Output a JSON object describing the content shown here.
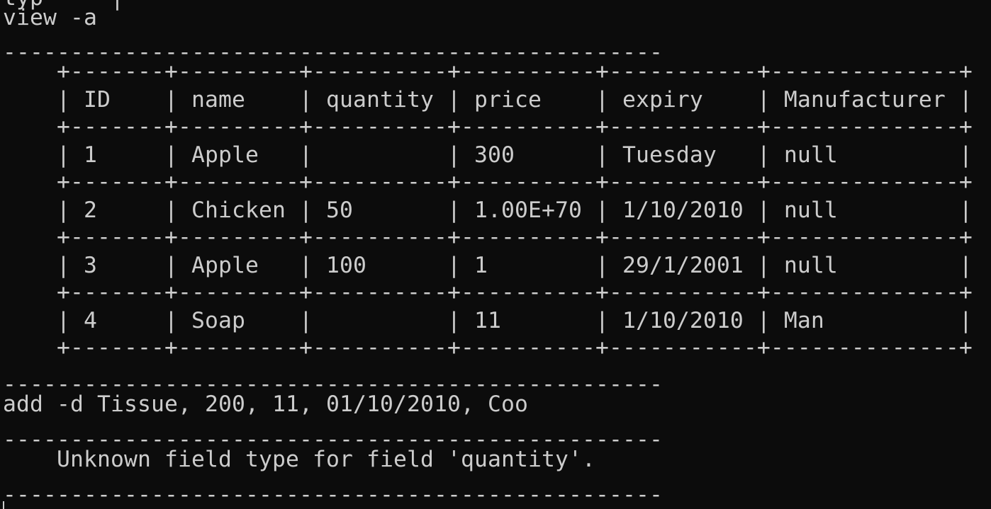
{
  "terminal": {
    "lines": [
      "typ  -  |",
      "view -a",
      "-------------------------------------------------",
      "    +-------+---------+----------+----------+-----------+--------------+",
      "    | ID    | name    | quantity | price    | expiry    | Manufacturer |",
      "    +-------+---------+----------+----------+-----------+--------------+",
      "    | 1     | Apple   |          | 300      | Tuesday   | null         |",
      "    +-------+---------+----------+----------+-----------+--------------+",
      "    | 2     | Chicken | 50       | 1.00E+70 | 1/10/2010 | null         |",
      "    +-------+---------+----------+----------+-----------+--------------+",
      "    | 3     | Apple   | 100      | 1        | 29/1/2001 | null         |",
      "    +-------+---------+----------+----------+-----------+--------------+",
      "    | 4     | Soap    |          | 11       | 1/10/2010 | Man          |",
      "    +-------+---------+----------+----------+-----------+--------------+",
      "-------------------------------------------------",
      "add -d Tissue, 200, 11, 01/10/2010, Coo",
      "-------------------------------------------------",
      "    Unknown field type for field 'quantity'.",
      "-------------------------------------------------"
    ]
  }
}
